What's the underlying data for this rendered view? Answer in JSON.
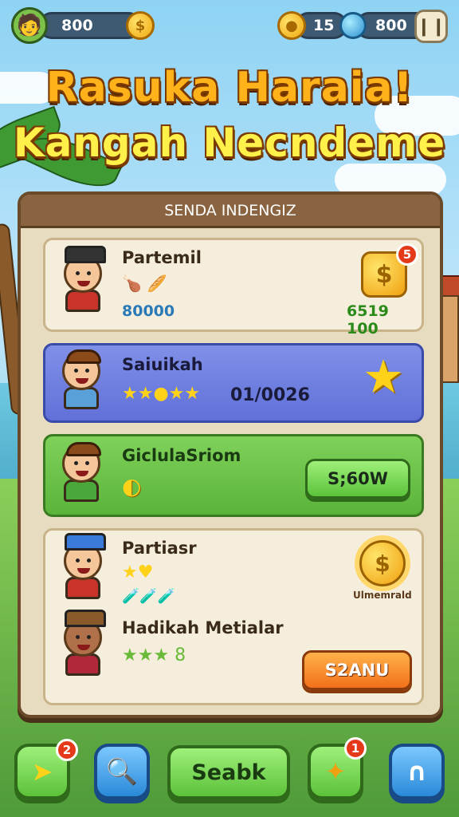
{
  "hud": {
    "player_coins": "800",
    "gem_count": "15",
    "gold": "800",
    "pause_symbol": "❙❙"
  },
  "title": {
    "line1": "Rasuka Haraia!",
    "line2": "Kangah Necndeme"
  },
  "panel": {
    "header": "SENDA INDENGIZ",
    "rows": [
      {
        "name": "Partemil",
        "items": "🍗 🥖",
        "score": "80000",
        "reward_value": "6519 100",
        "reward_icon": "$",
        "badge": "5"
      },
      {
        "name": "Saiuikah",
        "stars": "★★●★★",
        "score": "01/0026",
        "reward_icon": "★"
      },
      {
        "name": "GiclulaSriom",
        "item_icon": "◐",
        "button_label": "S;60W"
      },
      {
        "name": "Partiasr",
        "stars": "★♥",
        "items": "🧪🧪🧪",
        "reward_icon": "$",
        "reward_label": "Ulmemrald"
      },
      {
        "name": "Hadikah Metialar",
        "stars": "★★★ 8",
        "button_label": "S2ANU"
      }
    ]
  },
  "nav": {
    "left_badge": "2",
    "center_label": "Seabk",
    "right_badge": "1"
  }
}
